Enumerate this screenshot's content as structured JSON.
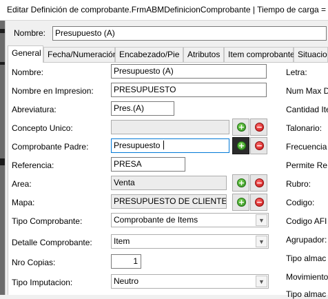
{
  "window": {
    "title": "Editar Definición de comprobante.FrmABMDefinicionComprobante | Tiempo de carga = "
  },
  "header": {
    "nombre_label": "Nombre:",
    "nombre_value": "Presupuesto (A)"
  },
  "tabs": [
    {
      "label": "General",
      "active": true
    },
    {
      "label": "Fecha/Numeración"
    },
    {
      "label": "Encabezado/Pie"
    },
    {
      "label": "Atributos"
    },
    {
      "label": "Item comprobante"
    },
    {
      "label": "Situacion"
    }
  ],
  "form": {
    "nombre": {
      "label": "Nombre:",
      "value": "Presupuesto (A)"
    },
    "nombre_impresion": {
      "label": "Nombre en Impresion:",
      "value": "PRESUPUESTO"
    },
    "abreviatura": {
      "label": "Abreviatura:",
      "value": "Pres.(A)"
    },
    "concepto_unico": {
      "label": "Concepto Unico:",
      "value": ""
    },
    "comprobante_padre": {
      "label": "Comprobante Padre:",
      "value": "Presupuesto "
    },
    "referencia": {
      "label": "Referencia:",
      "value": "PRESA"
    },
    "area": {
      "label": "Area:",
      "value": "Venta"
    },
    "mapa": {
      "label": "Mapa:",
      "value": "PRESUPUESTO DE CLIENTE"
    },
    "tipo_comprobante": {
      "label": "Tipo Comprobante:",
      "value": "Comprobante de Items"
    },
    "detalle_comprobante": {
      "label": "Detalle Comprobante:",
      "value": "Item"
    },
    "nro_copias": {
      "label": "Nro Copias:",
      "value": "1"
    },
    "tipo_imputacion": {
      "label": "Tipo Imputacion:",
      "value": "Neutro"
    }
  },
  "right_column_labels": [
    "Letra:",
    "Num Max D",
    "Cantidad Ite",
    "Talonario:",
    "Frecuencia",
    "Permite Re",
    "Rubro:",
    "Codigo:",
    "Codigo AFI",
    "Agrupador:",
    "Tipo almac",
    "Movimiento",
    "Tipo almac"
  ],
  "icons": {
    "add": "add-icon",
    "delete": "delete-icon",
    "dropdown": "chevron-down-icon"
  }
}
